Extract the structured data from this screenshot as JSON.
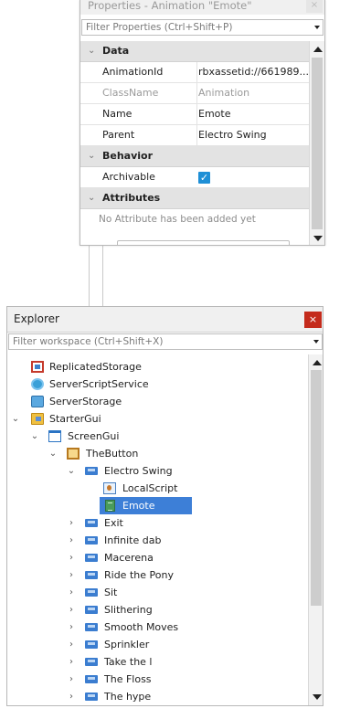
{
  "properties": {
    "title": "Properties - Animation \"Emote\"",
    "close": "×",
    "filter_placeholder": "Filter Properties (Ctrl+Shift+P)",
    "sections": [
      {
        "name": "Data",
        "rows": [
          {
            "name": "AnimationId",
            "value": "rbxassetid://661989..."
          },
          {
            "name": "ClassName",
            "value": "Animation",
            "dim": true
          },
          {
            "name": "Name",
            "value": "Emote"
          },
          {
            "name": "Parent",
            "value": "Electro Swing"
          }
        ]
      },
      {
        "name": "Behavior",
        "rows": [
          {
            "name": "Archivable",
            "checked": true
          }
        ]
      },
      {
        "name": "Attributes",
        "note": "No Attribute has been added yet"
      }
    ]
  },
  "explorer": {
    "title": "Explorer",
    "close": "×",
    "filter_placeholder": "Filter workspace (Ctrl+Shift+X)",
    "items": [
      {
        "label": "ReplicatedStorage",
        "icon": "replicated-storage-icon"
      },
      {
        "label": "ServerScriptService",
        "icon": "server-script-service-icon"
      },
      {
        "label": "ServerStorage",
        "icon": "server-storage-icon"
      },
      {
        "label": "StarterGui",
        "icon": "starter-gui-icon",
        "expanded": true
      },
      {
        "label": "ScreenGui",
        "icon": "screen-gui-icon",
        "expanded": true
      },
      {
        "label": "TheButton",
        "icon": "text-button-icon",
        "expanded": true
      },
      {
        "label": "Electro Swing",
        "icon": "animation-icon",
        "expanded": true
      },
      {
        "label": "LocalScript",
        "icon": "local-script-icon"
      },
      {
        "label": "Emote",
        "icon": "animation-emote-icon",
        "selected": true
      },
      {
        "label": "Exit",
        "icon": "animation-icon"
      },
      {
        "label": "Infinite dab",
        "icon": "animation-icon"
      },
      {
        "label": "Macerena",
        "icon": "animation-icon"
      },
      {
        "label": "Ride the Pony",
        "icon": "animation-icon"
      },
      {
        "label": "Sit",
        "icon": "animation-icon"
      },
      {
        "label": "Slithering",
        "icon": "animation-icon"
      },
      {
        "label": "Smooth Moves",
        "icon": "animation-icon"
      },
      {
        "label": "Sprinkler",
        "icon": "animation-icon"
      },
      {
        "label": "Take the l",
        "icon": "animation-icon"
      },
      {
        "label": "The Floss",
        "icon": "animation-icon"
      },
      {
        "label": "The hype",
        "icon": "animation-icon"
      }
    ]
  },
  "colors": {
    "selection": "#3d7fd7",
    "close_active": "#c42b1c",
    "checkbox": "#1e8fd6"
  }
}
